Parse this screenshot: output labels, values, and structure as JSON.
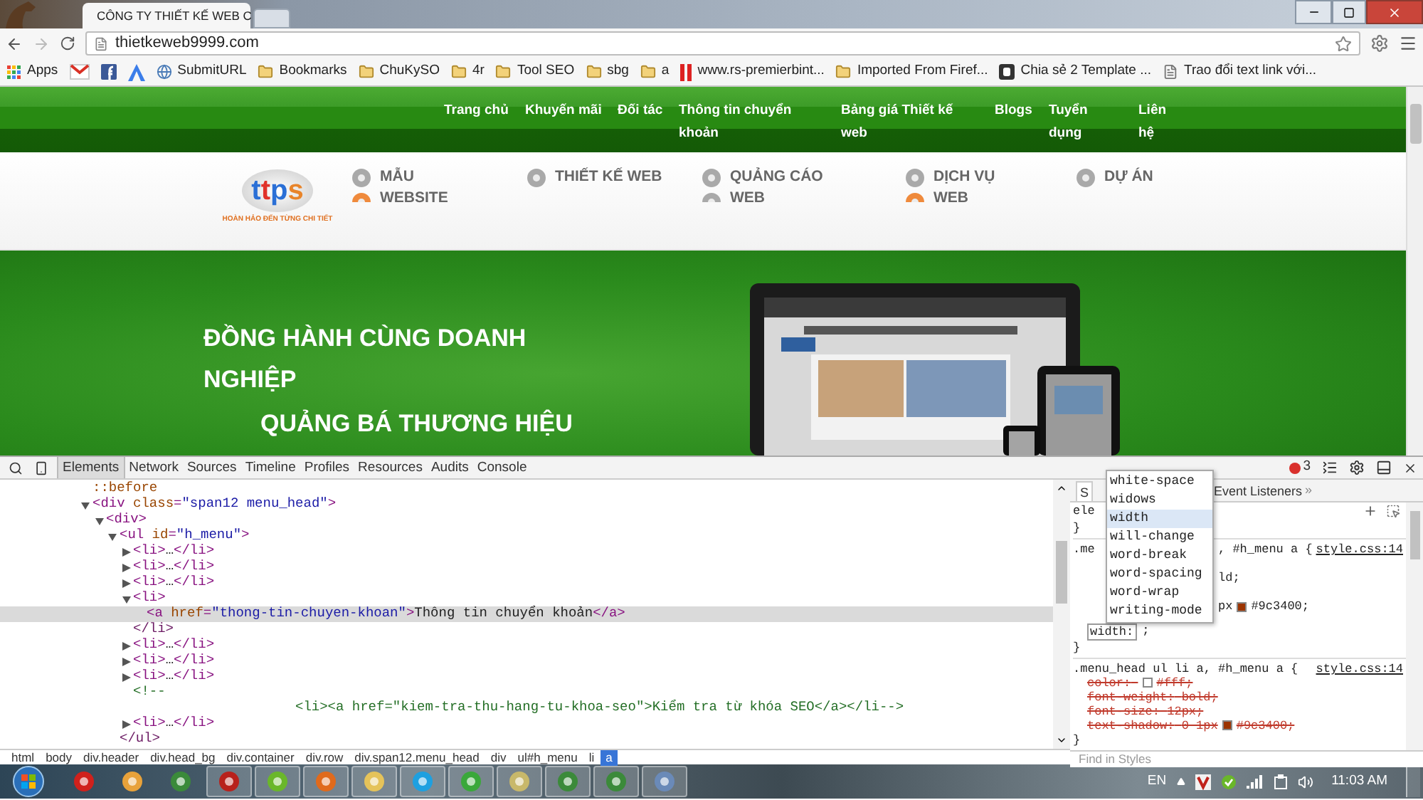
{
  "browser": {
    "tabs": [
      {
        "title": "CÔNG TY THIẾT KẾ WEB C",
        "selected": true
      },
      {
        "selected": false
      }
    ],
    "url": "thietkeweb9999.com",
    "bookmarks": [
      {
        "kind": "apps",
        "label": "Apps"
      },
      {
        "kind": "gmail"
      },
      {
        "kind": "facebook"
      },
      {
        "kind": "adwords"
      },
      {
        "kind": "page",
        "label": "SubmitURL"
      },
      {
        "kind": "folder",
        "label": "Bookmarks"
      },
      {
        "kind": "folder",
        "label": "ChuKySO"
      },
      {
        "kind": "folder",
        "label": "4r"
      },
      {
        "kind": "folder",
        "label": "Tool SEO"
      },
      {
        "kind": "folder",
        "label": "sbg"
      },
      {
        "kind": "folder",
        "label": "a"
      },
      {
        "kind": "bars",
        "label": "www.rs-premierbint..."
      },
      {
        "kind": "folder",
        "label": "Imported From Firef..."
      },
      {
        "kind": "blogger",
        "label": "Chia sẻ 2 Template ..."
      },
      {
        "kind": "doc",
        "label": "Trao đổi text link với..."
      }
    ]
  },
  "page": {
    "nav": [
      "Trang chủ",
      "Khuyến mãi",
      "Đối tác",
      "Thông tin chuyển khoản",
      "Bảng giá Thiết kế web",
      "Blogs",
      "Tuyển dụng",
      "Liên hệ"
    ],
    "logo": {
      "mark": "ttps",
      "tagline": "HOÀN HẢO ĐẾN TỪNG CHI TIẾT"
    },
    "menu": [
      {
        "label": "MẪU WEBSITE",
        "icons": [
          {
            "color": "#a9a9a9"
          },
          {
            "color": "#ef8a3c"
          }
        ]
      },
      {
        "label": "THIẾT KẾ WEB",
        "icons": [
          {
            "color": "#a9a9a9"
          }
        ]
      },
      {
        "label": "QUẢNG CÁO WEB",
        "icons": [
          {
            "color": "#a9a9a9"
          },
          {
            "color": "#a9a9a9"
          }
        ]
      },
      {
        "label": "DỊCH VỤ WEB",
        "icons": [
          {
            "color": "#a9a9a9"
          },
          {
            "color": "#ef8a3c"
          }
        ]
      },
      {
        "label": "DỰ ÁN",
        "icons": [
          {
            "color": "#a9a9a9"
          }
        ]
      }
    ],
    "hero": [
      "ĐỒNG HÀNH CÙNG DOANH NGHIỆP",
      "QUẢNG BÁ THƯƠNG HIỆU"
    ]
  },
  "devtools": {
    "tabs": [
      {
        "label": "Elements",
        "selected": true
      },
      {
        "label": "Network",
        "selected": false
      },
      {
        "label": "Sources",
        "selected": false
      },
      {
        "label": "Timeline",
        "selected": false
      },
      {
        "label": "Profiles",
        "selected": false
      },
      {
        "label": "Resources",
        "selected": false
      },
      {
        "label": "Audits",
        "selected": false
      },
      {
        "label": "Console",
        "selected": false
      }
    ],
    "error_count": "3",
    "dom_tree": [
      {
        "kind": "pseudo",
        "text": "::before",
        "selected": false
      },
      {
        "kind": "element",
        "text": "<div class=\"span12 menu_head\">",
        "expanded": true,
        "selected": false,
        "children": [
          {
            "kind": "element",
            "text": "<div>",
            "expanded": true,
            "selected": false,
            "children": [
              {
                "kind": "element",
                "text": "<ul id=\"h_menu\">",
                "expanded": true,
                "selected": false,
                "children": [
                  {
                    "kind": "element",
                    "text": "<li>…</li>",
                    "expanded": false,
                    "selected": false
                  },
                  {
                    "kind": "element",
                    "text": "<li>…</li>",
                    "expanded": false,
                    "selected": false
                  },
                  {
                    "kind": "element",
                    "text": "<li>…</li>",
                    "expanded": false,
                    "selected": false
                  },
                  {
                    "kind": "element",
                    "text": "<li>",
                    "expanded": true,
                    "selected": false,
                    "children": [
                      {
                        "kind": "element",
                        "text": "<a href=\"thong-tin-chuyen-khoan\">Thông tin chuyển khoản</a>",
                        "selected": true
                      }
                    ]
                  },
                  {
                    "kind": "close",
                    "text": "</li>",
                    "selected": false
                  },
                  {
                    "kind": "element",
                    "text": "<li>…</li>",
                    "expanded": false,
                    "selected": false
                  },
                  {
                    "kind": "element",
                    "text": "<li>…</li>",
                    "expanded": false,
                    "selected": false
                  },
                  {
                    "kind": "element",
                    "text": "<li>…</li>",
                    "expanded": false,
                    "selected": false
                  },
                  {
                    "kind": "comment",
                    "text": "<!--",
                    "selected": false
                  },
                  {
                    "kind": "comment-body",
                    "text": "<li><a href=\"kiem-tra-thu-hang-tu-khoa-seo\">Kiểm tra từ khóa SEO</a></li-->",
                    "selected": false
                  },
                  {
                    "kind": "element",
                    "text": "<li>…</li>",
                    "expanded": false,
                    "selected": false
                  }
                ]
              },
              {
                "kind": "close",
                "text": "</ul>",
                "selected": false
              }
            ]
          }
        ]
      }
    ],
    "breadcrumb": [
      {
        "label": "html",
        "selected": false
      },
      {
        "label": "body",
        "selected": false
      },
      {
        "label": "div.header",
        "selected": false
      },
      {
        "label": "div.head_bg",
        "selected": false
      },
      {
        "label": "div.container",
        "selected": false
      },
      {
        "label": "div.row",
        "selected": false
      },
      {
        "label": "div.span12.menu_head",
        "selected": false
      },
      {
        "label": "div",
        "selected": false
      },
      {
        "label": "ul#h_menu",
        "selected": false
      },
      {
        "label": "li",
        "selected": false
      },
      {
        "label": "a",
        "selected": true
      }
    ],
    "styles": {
      "tabs": [
        {
          "label": "S",
          "selected": true
        },
        {
          "label": "Event Listeners",
          "selected": false
        }
      ],
      "more": "»",
      "element_rule": {
        "selector": "ele",
        "close": "}"
      },
      "edited_rule": {
        "selector": ".me",
        "selector_rest": ", #h_menu a {",
        "source": "style.css:14",
        "rows": [
          {
            "text": "ld;"
          },
          {
            "text": "px",
            "color": "#9c3400",
            "value": "#9c3400;"
          }
        ],
        "editing": {
          "name": "width:",
          "rest": ";"
        },
        "close": "}"
      },
      "rule": {
        "selector": ".menu_head ul li a, #h_menu a {",
        "source": "style.css:14",
        "props": [
          {
            "name": "color:",
            "color": "#ffffff",
            "value": "#fff;",
            "overridden": true
          },
          {
            "name": "font-weight:",
            "value": "bold;",
            "overridden": true
          },
          {
            "name": "font-size:",
            "value": "12px;",
            "overridden": true
          },
          {
            "name": "text-shadow:",
            "pre": "0 1px",
            "color": "#9c3400",
            "value": "#9c3400;",
            "overridden": true
          }
        ],
        "close": "}"
      },
      "suggestions": [
        {
          "label": "white-space",
          "selected": false
        },
        {
          "label": "widows",
          "selected": false
        },
        {
          "label": "width",
          "selected": true
        },
        {
          "label": "will-change",
          "selected": false
        },
        {
          "label": "word-break",
          "selected": false
        },
        {
          "label": "word-spacing",
          "selected": false
        },
        {
          "label": "word-wrap",
          "selected": false
        },
        {
          "label": "writing-mode",
          "selected": false
        }
      ],
      "find": {
        "placeholder": "Find in Styles"
      }
    }
  },
  "taskbar": {
    "apps": [
      {
        "kind": "opera",
        "open": false
      },
      {
        "kind": "media",
        "open": false
      },
      {
        "kind": "chrome",
        "open": false
      },
      {
        "kind": "filezilla",
        "open": true
      },
      {
        "kind": "green",
        "open": true
      },
      {
        "kind": "firefox",
        "open": true
      },
      {
        "kind": "folder",
        "open": true
      },
      {
        "kind": "skype",
        "open": true
      },
      {
        "kind": "film",
        "open": true
      },
      {
        "kind": "notepad",
        "open": true
      },
      {
        "kind": "chrome",
        "open": true
      },
      {
        "kind": "chrome",
        "open": true
      },
      {
        "kind": "paint",
        "open": true
      }
    ],
    "language": "EN",
    "time": "11:03 AM"
  }
}
